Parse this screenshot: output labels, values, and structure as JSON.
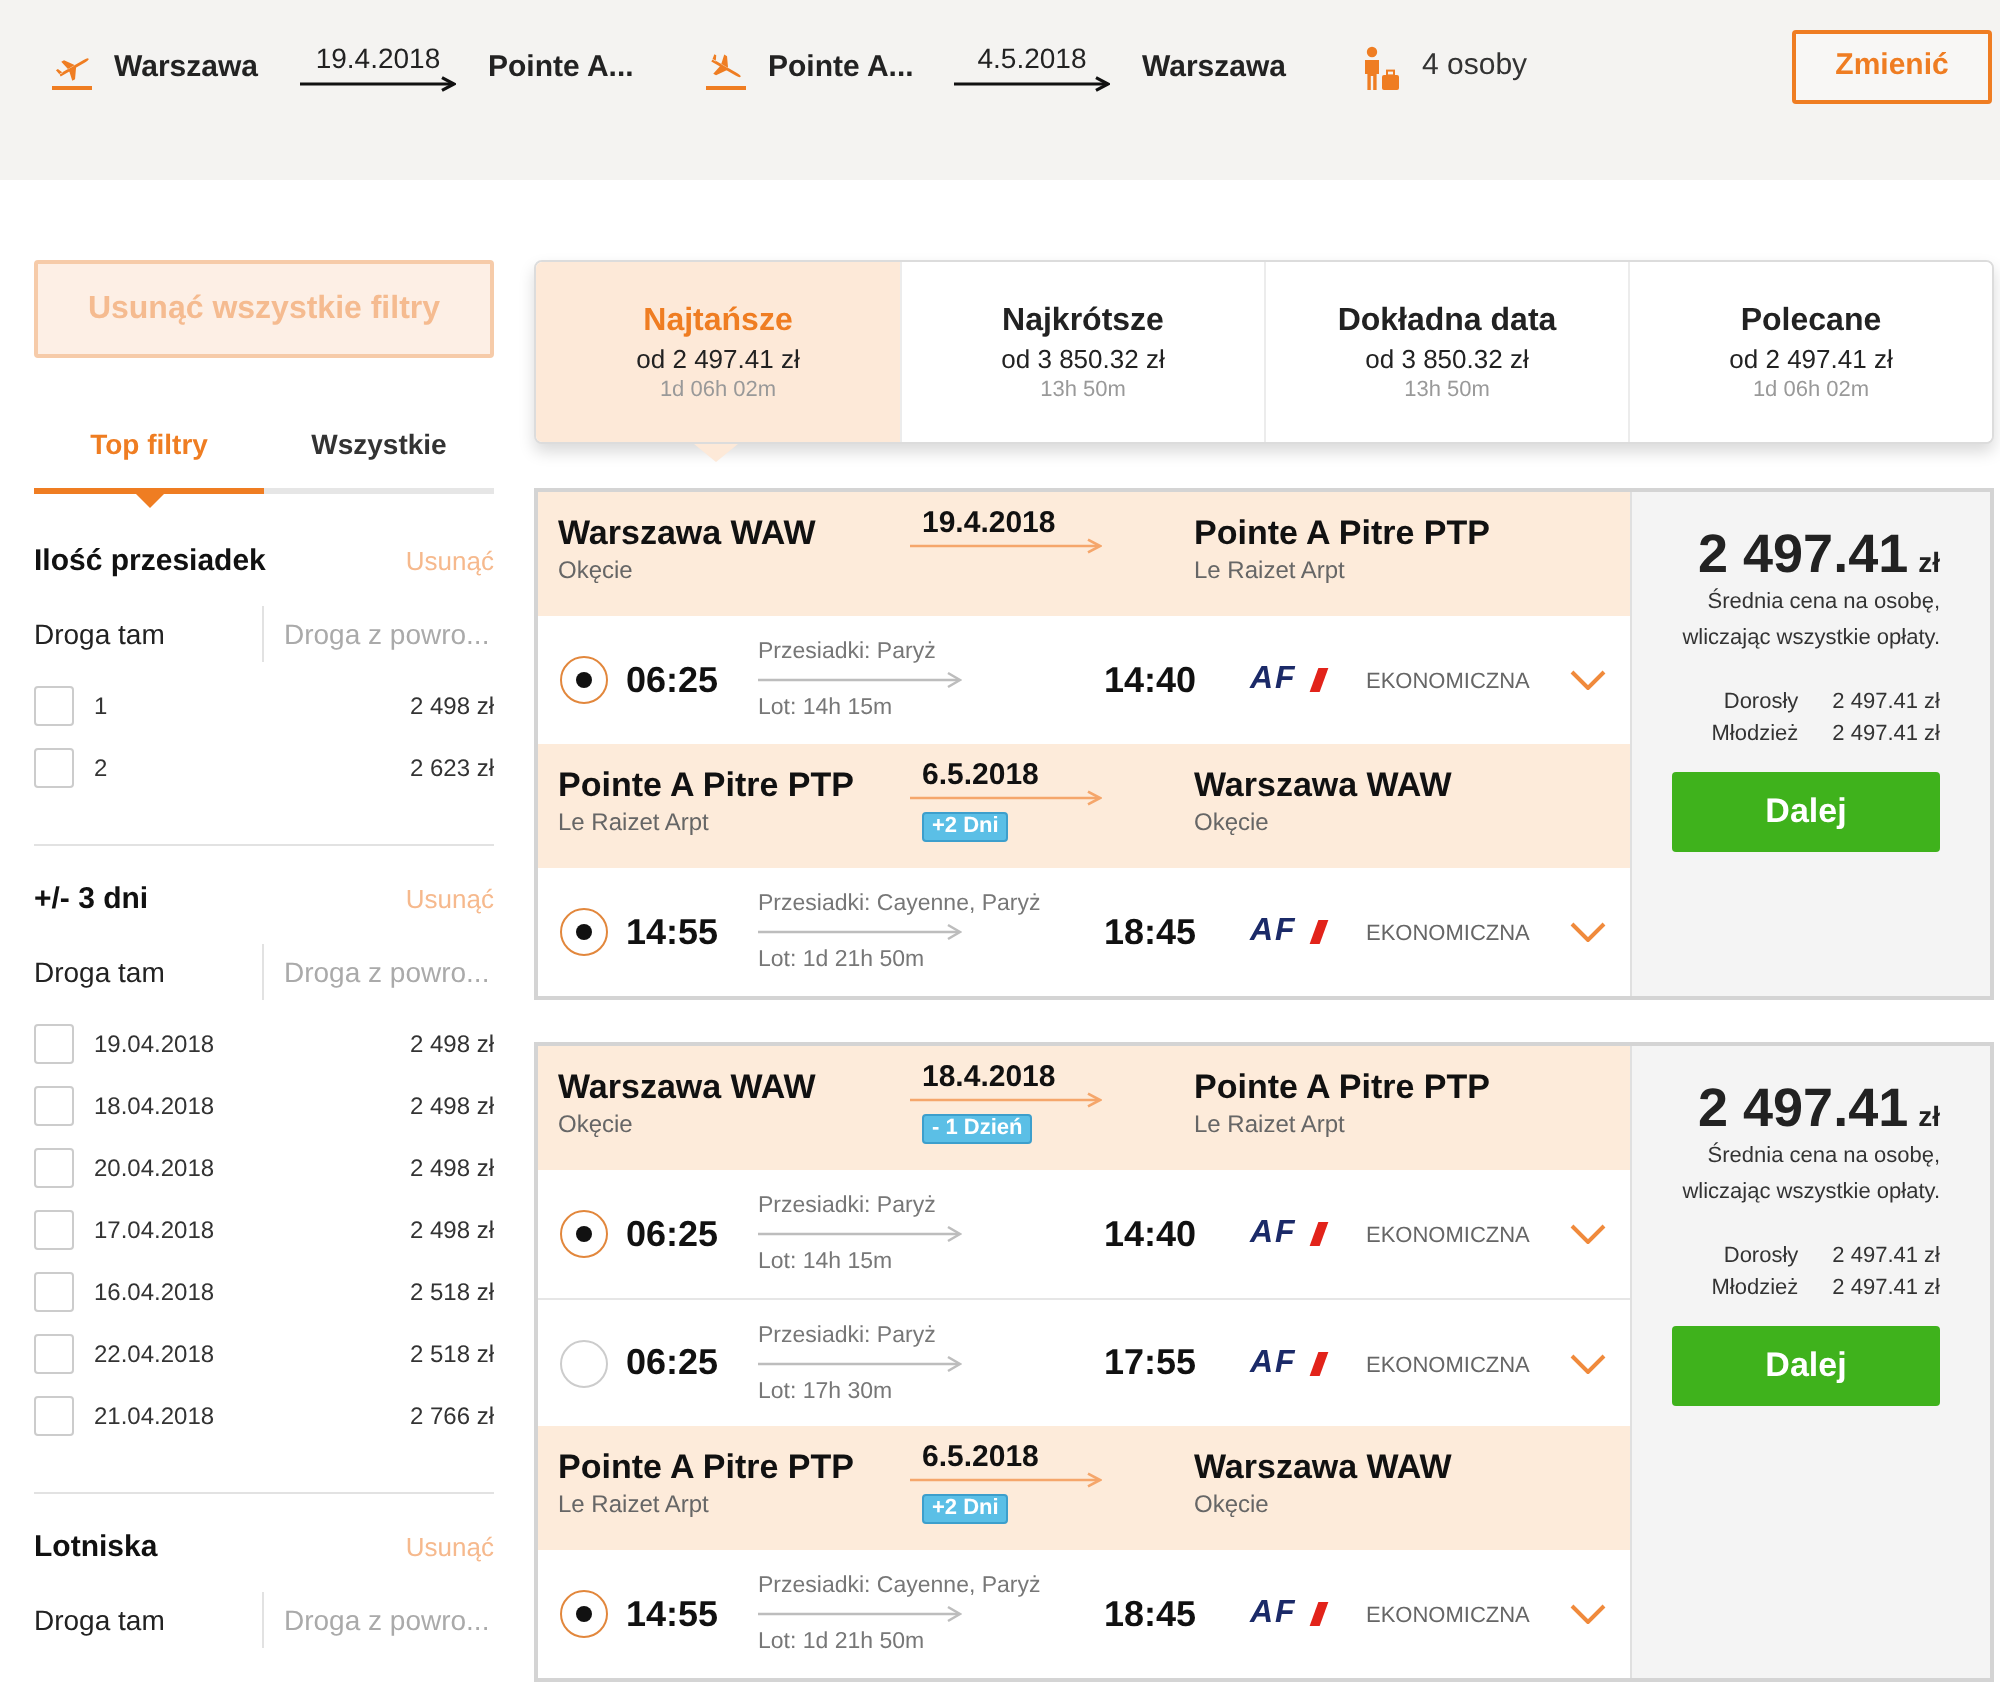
{
  "search_summary": {
    "legs": [
      {
        "kind": "departure",
        "from": "Warszawa",
        "date": "19.4.2018",
        "to": "Pointe A..."
      },
      {
        "kind": "return",
        "from": "Pointe A...",
        "date": "4.5.2018",
        "to": "Warszawa"
      }
    ],
    "passengers": "4 osoby",
    "change_button": "Zmienić"
  },
  "sidebar": {
    "clear_all_button": {
      "label": "Usunąć wszystkie filtry",
      "disabled": true
    },
    "tabs": [
      {
        "label": "Top filtry",
        "selected": true
      },
      {
        "label": "Wszystkie",
        "selected": false
      }
    ],
    "filter_groups": [
      {
        "title": "Ilość przesiadek",
        "clear_link": {
          "label": "Usunąć",
          "disabled": true
        },
        "direction_tabs": [
          {
            "label": "Droga tam",
            "selected": true
          },
          {
            "label": "Droga z powro...",
            "selected": false
          }
        ],
        "options": [
          {
            "label": "1",
            "price": "2 498 zł",
            "checked": false
          },
          {
            "label": "2",
            "price": "2 623 zł",
            "checked": false
          }
        ]
      },
      {
        "title": "+/- 3 dni",
        "clear_link": {
          "label": "Usunąć",
          "disabled": true
        },
        "direction_tabs": [
          {
            "label": "Droga tam",
            "selected": true
          },
          {
            "label": "Droga z powro...",
            "selected": false
          }
        ],
        "options": [
          {
            "label": "19.04.2018",
            "price": "2 498 zł",
            "checked": false
          },
          {
            "label": "18.04.2018",
            "price": "2 498 zł",
            "checked": false
          },
          {
            "label": "20.04.2018",
            "price": "2 498 zł",
            "checked": false
          },
          {
            "label": "17.04.2018",
            "price": "2 498 zł",
            "checked": false
          },
          {
            "label": "16.04.2018",
            "price": "2 518 zł",
            "checked": false
          },
          {
            "label": "22.04.2018",
            "price": "2 518 zł",
            "checked": false
          },
          {
            "label": "21.04.2018",
            "price": "2 766 zł",
            "checked": false
          }
        ]
      },
      {
        "title": "Lotniska",
        "clear_link": {
          "label": "Usunąć",
          "disabled": true
        },
        "direction_tabs": [
          {
            "label": "Droga tam",
            "selected": true
          },
          {
            "label": "Droga z powro...",
            "selected": false
          }
        ]
      }
    ]
  },
  "sort_tabs": [
    {
      "title": "Najtańsze",
      "price": "od 2 497.41 zł",
      "duration": "1d 06h 02m",
      "selected": true
    },
    {
      "title": "Najkrótsze",
      "price": "od 3 850.32 zł",
      "duration": "13h 50m",
      "selected": false
    },
    {
      "title": "Dokładna data",
      "price": "od 3 850.32 zł",
      "duration": "13h 50m",
      "selected": false
    },
    {
      "title": "Polecane",
      "price": "od 2 497.41 zł",
      "duration": "1d 06h 02m",
      "selected": false
    }
  ],
  "results": [
    {
      "segments": [
        {
          "from": {
            "city": "Warszawa WAW",
            "airport": "Okęcie"
          },
          "date": "19.4.2018",
          "to": {
            "city": "Pointe A Pitre PTP",
            "airport": "Le Raizet Arpt"
          },
          "flights": [
            {
              "selected": true,
              "departure": "06:25",
              "stops": "Przesiadki: Paryż",
              "duration": "Lot: 14h 15m",
              "arrival": "14:40",
              "airline": "AF",
              "cabin": "EKONOMICZNA"
            }
          ]
        },
        {
          "from": {
            "city": "Pointe A Pitre PTP",
            "airport": "Le Raizet Arpt"
          },
          "date": "6.5.2018",
          "day_shift": "+2 Dni",
          "to": {
            "city": "Warszawa WAW",
            "airport": "Okęcie"
          },
          "flights": [
            {
              "selected": true,
              "departure": "14:55",
              "stops": "Przesiadki: Cayenne, Paryż",
              "duration": "Lot: 1d 21h 50m",
              "arrival": "18:45",
              "airline": "AF",
              "cabin": "EKONOMICZNA"
            }
          ]
        }
      ],
      "price": {
        "amount": "2 497.41",
        "currency": "zł",
        "note": "Średnia cena na osobę, wliczając wszystkie opłaty.",
        "fares": [
          {
            "label": "Dorosły",
            "value": "2 497.41 zł"
          },
          {
            "label": "Młodzież",
            "value": "2 497.41 zł"
          }
        ],
        "button": "Dalej"
      }
    },
    {
      "segments": [
        {
          "from": {
            "city": "Warszawa WAW",
            "airport": "Okęcie"
          },
          "date": "18.4.2018",
          "day_shift": "- 1 Dzień",
          "to": {
            "city": "Pointe A Pitre PTP",
            "airport": "Le Raizet Arpt"
          },
          "flights": [
            {
              "selected": true,
              "departure": "06:25",
              "stops": "Przesiadki: Paryż",
              "duration": "Lot: 14h 15m",
              "arrival": "14:40",
              "airline": "AF",
              "cabin": "EKONOMICZNA"
            },
            {
              "selected": false,
              "departure": "06:25",
              "stops": "Przesiadki: Paryż",
              "duration": "Lot: 17h 30m",
              "arrival": "17:55",
              "airline": "AF",
              "cabin": "EKONOMICZNA"
            }
          ]
        },
        {
          "from": {
            "city": "Pointe A Pitre PTP",
            "airport": "Le Raizet Arpt"
          },
          "date": "6.5.2018",
          "day_shift": "+2 Dni",
          "to": {
            "city": "Warszawa WAW",
            "airport": "Okęcie"
          },
          "flights": [
            {
              "selected": true,
              "departure": "14:55",
              "stops": "Przesiadki: Cayenne, Paryż",
              "duration": "Lot: 1d 21h 50m",
              "arrival": "18:45",
              "airline": "AF",
              "cabin": "EKONOMICZNA"
            }
          ]
        }
      ],
      "price": {
        "amount": "2 497.41",
        "currency": "zł",
        "note": "Średnia cena na osobę, wliczając wszystkie opłaty.",
        "fares": [
          {
            "label": "Dorosły",
            "value": "2 497.41 zł"
          },
          {
            "label": "Młodzież",
            "value": "2 497.41 zł"
          }
        ],
        "button": "Dalej"
      }
    }
  ]
}
